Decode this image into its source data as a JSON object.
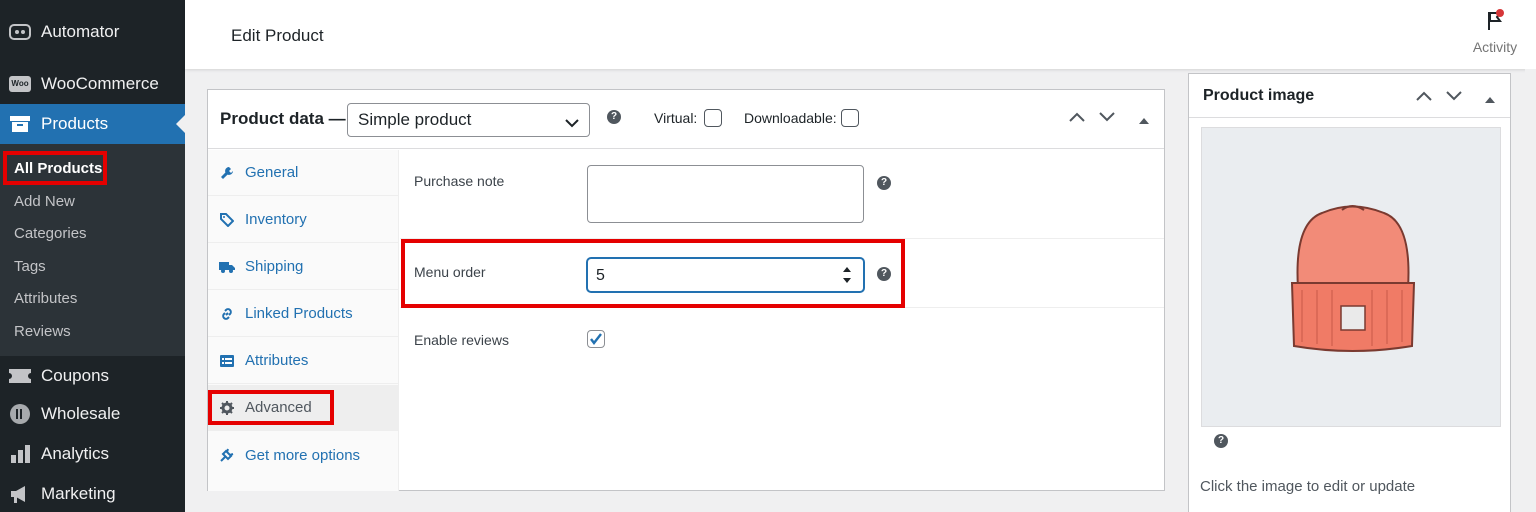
{
  "sidebar": {
    "items": [
      {
        "label": "Automator",
        "icon": "automator-icon"
      },
      {
        "label": "WooCommerce",
        "icon": "woocommerce-icon"
      },
      {
        "label": "Products",
        "icon": "products-icon"
      },
      {
        "label": "Coupons",
        "icon": "coupons-icon"
      },
      {
        "label": "Wholesale",
        "icon": "wholesale-icon"
      },
      {
        "label": "Analytics",
        "icon": "analytics-icon"
      },
      {
        "label": "Marketing",
        "icon": "marketing-icon"
      }
    ],
    "woo_badge": "Woo",
    "submenu": [
      "All Products",
      "Add New",
      "Categories",
      "Tags",
      "Attributes",
      "Reviews"
    ]
  },
  "header": {
    "title": "Edit Product",
    "activity_label": "Activity"
  },
  "product_data": {
    "title": "Product data —",
    "type_select": "Simple product",
    "virtual_label": "Virtual:",
    "downloadable_label": "Downloadable:",
    "help": "?",
    "tabs": [
      {
        "label": "General",
        "icon": "wrench-icon"
      },
      {
        "label": "Inventory",
        "icon": "tag-icon"
      },
      {
        "label": "Shipping",
        "icon": "truck-icon"
      },
      {
        "label": "Linked Products",
        "icon": "link-icon"
      },
      {
        "label": "Attributes",
        "icon": "list-icon"
      },
      {
        "label": "Advanced",
        "icon": "gear-icon"
      },
      {
        "label": "Get more options",
        "icon": "plugin-icon"
      }
    ],
    "fields": {
      "purchase_note_label": "Purchase note",
      "purchase_note_value": "",
      "menu_order_label": "Menu order",
      "menu_order_value": "5",
      "enable_reviews_label": "Enable reviews",
      "enable_reviews_checked": true
    }
  },
  "product_image": {
    "title": "Product image",
    "caption": "Click the image to edit or update",
    "image_subject": "orange beanie hat"
  },
  "colors": {
    "sidebar_bg": "#1d2327",
    "accent": "#2271b1",
    "highlight": "#e50000"
  }
}
